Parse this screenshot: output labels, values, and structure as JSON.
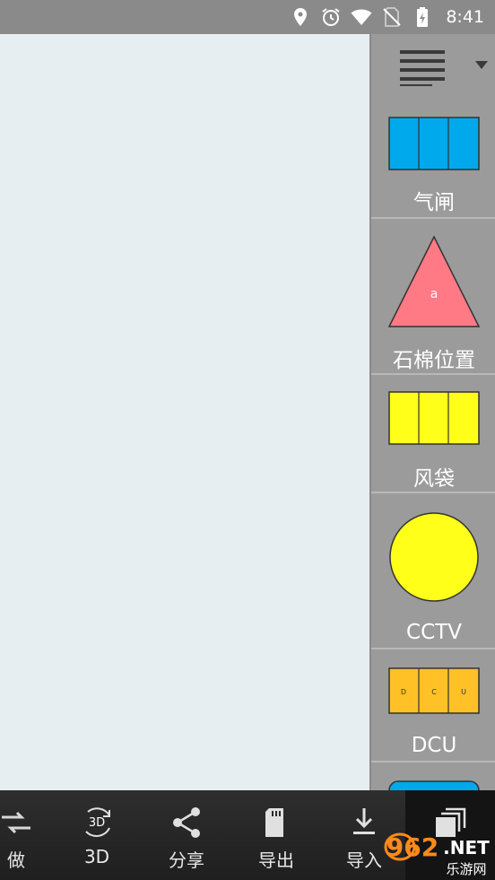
{
  "status_bar": {
    "time": "8:41",
    "icons": [
      "location-icon",
      "alarm-icon",
      "wifi-icon",
      "no-sim-icon",
      "battery-charging-icon"
    ]
  },
  "palette": {
    "header_icons": [
      "list-menu-icon",
      "dropdown-arrow-icon"
    ],
    "items": [
      {
        "label": "气闸",
        "shape": "three-panel-rect",
        "color": "#00a8ec"
      },
      {
        "label": "石棉位置",
        "shape": "triangle",
        "color": "#ff7a85",
        "inner_text": "a"
      },
      {
        "label": "风袋",
        "shape": "three-panel-rect",
        "color": "#ffff1a"
      },
      {
        "label": "CCTV",
        "shape": "circle",
        "color": "#ffff1a"
      },
      {
        "label": "DCU",
        "shape": "three-panel-rect-letters",
        "color": "#ffc125",
        "panel_letters": [
          "D",
          "C",
          "U"
        ]
      },
      {
        "label": "",
        "shape": "partial-rounded",
        "color": "#00a8ec"
      }
    ]
  },
  "toolbar": {
    "buttons": [
      {
        "label": "做",
        "icon": "redo-icon"
      },
      {
        "label": "3D",
        "icon": "rotate-3d-icon",
        "icon_text": "3D"
      },
      {
        "label": "分享",
        "icon": "share-icon"
      },
      {
        "label": "导出",
        "icon": "sd-card-icon"
      },
      {
        "label": "导入",
        "icon": "download-icon"
      },
      {
        "label": "",
        "icon": "copy-layers-icon"
      }
    ]
  },
  "watermark": {
    "brand_number": "962",
    "brand_suffix": ".NET",
    "sub_text": "乐游网"
  }
}
